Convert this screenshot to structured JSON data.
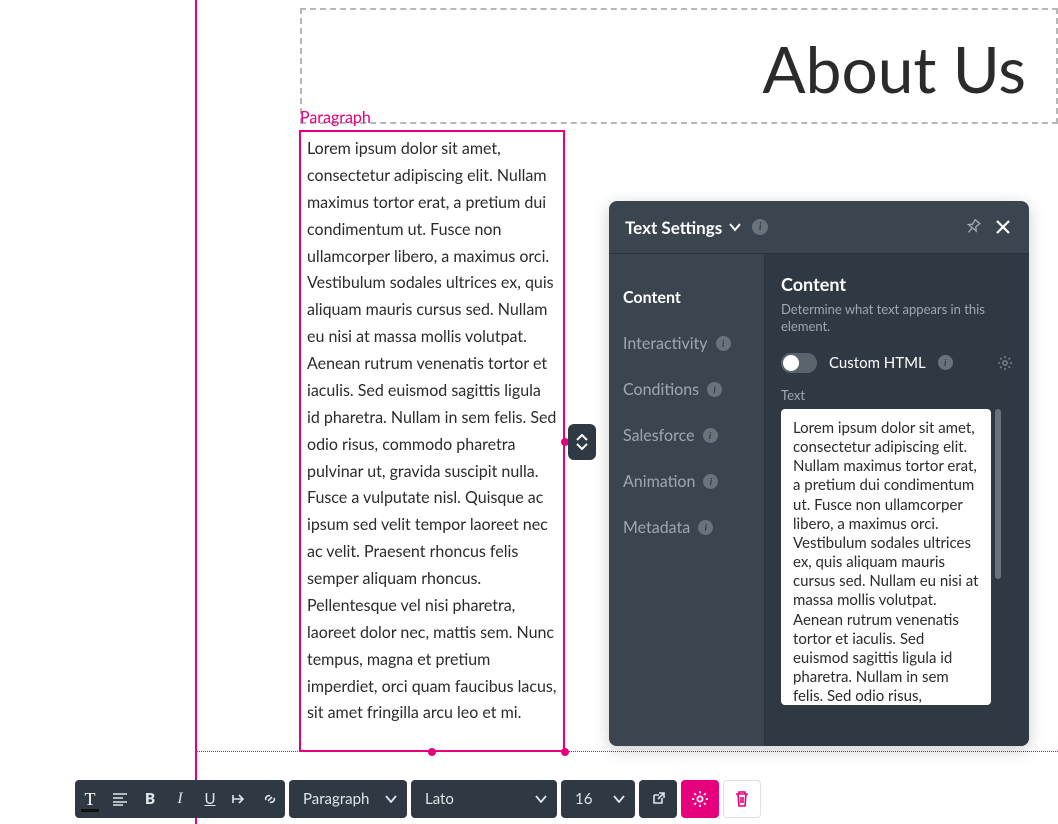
{
  "canvas": {
    "heading": "About Us",
    "selection_label": "Paragraph",
    "paragraph_text": "Lorem ipsum dolor sit amet, consectetur adipiscing elit. Nullam maximus tortor erat, a pretium dui condimentum ut. Fusce non ullamcorper libero, a maximus orci. Vestibulum sodales ultrices ex, quis aliquam mauris cursus sed. Nullam eu nisi at massa mollis volutpat. Aenean rutrum venenatis tortor et iaculis. Sed euismod sagittis ligula id pharetra. Nullam in sem felis. Sed odio risus, commodo pharetra pulvinar ut, gravida suscipit nulla. Fusce a vulputate nisl. Quisque ac ipsum sed velit tempor laoreet nec ac velit. Praesent rhoncus felis semper aliquam rhoncus. Pellentesque vel nisi pharetra, laoreet dolor nec, mattis sem. Nunc tempus, magna et pretium imperdiet, orci quam faucibus lacus, sit amet fringilla arcu leo et mi."
  },
  "panel": {
    "title": "Text Settings",
    "nav": [
      {
        "label": "Content",
        "active": true,
        "info": false
      },
      {
        "label": "Interactivity",
        "active": false,
        "info": true
      },
      {
        "label": "Conditions",
        "active": false,
        "info": true
      },
      {
        "label": "Salesforce",
        "active": false,
        "info": true
      },
      {
        "label": "Animation",
        "active": false,
        "info": true
      },
      {
        "label": "Metadata",
        "active": false,
        "info": true
      }
    ],
    "content": {
      "section_title": "Content",
      "section_desc": "Determine what text appears in this element.",
      "custom_html_label": "Custom HTML",
      "text_label": "Text",
      "text_value": "Lorem ipsum dolor sit amet, consectetur adipiscing elit. Nullam maximus tortor erat, a pretium dui condimentum ut. Fusce non ullamcorper libero, a maximus orci. Vestibulum sodales ultrices ex, quis aliquam mauris cursus sed. Nullam eu nisi at massa mollis volutpat. Aenean rutrum venenatis tortor et iaculis. Sed euismod sagittis ligula id pharetra. Nullam in sem felis. Sed odio risus,"
    }
  },
  "toolbar": {
    "style_select": "Paragraph",
    "font_select": "Lato",
    "size_select": "16"
  },
  "colors": {
    "accent": "#e6007e",
    "panel_bg": "#3a454f",
    "panel_inner": "#2f3943"
  }
}
